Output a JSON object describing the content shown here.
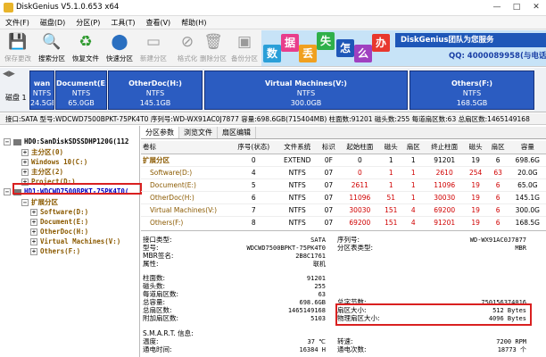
{
  "window": {
    "title": "DiskGenius V5.1.0.653 x64",
    "min": "—",
    "max": "□",
    "close": "✕"
  },
  "menu": [
    "文件(F)",
    "磁盘(D)",
    "分区(P)",
    "工具(T)",
    "查看(V)",
    "帮助(H)"
  ],
  "toolbar": [
    {
      "label": "保存更改",
      "icon": "save-icon",
      "glyph": "💾",
      "enabled": false
    },
    {
      "label": "搜索分区",
      "icon": "search-partition-icon",
      "glyph": "🔍",
      "enabled": true
    },
    {
      "label": "恢复文件",
      "icon": "recover-file-icon",
      "glyph": "♻",
      "enabled": true
    },
    {
      "label": "快速分区",
      "icon": "quick-partition-icon",
      "glyph": "⬤",
      "enabled": true
    },
    {
      "label": "新建分区",
      "icon": "new-partition-icon",
      "glyph": "▭",
      "enabled": false
    },
    {
      "label": "格式化",
      "icon": "format-icon",
      "glyph": "⊘",
      "enabled": false
    },
    {
      "label": "删除分区",
      "icon": "delete-partition-icon",
      "glyph": "🗑",
      "enabled": false
    },
    {
      "label": "备份分区",
      "icon": "backup-partition-icon",
      "glyph": "▣",
      "enabled": false
    }
  ],
  "banner": {
    "chars": [
      "数",
      "据",
      "丢",
      "失",
      "怎",
      "么",
      "办"
    ],
    "brand": "DiskGenius团队为您服务",
    "phone": "QQ: 4000089958(与电话同号)"
  },
  "diskbar": {
    "disk_label": "磁盘 1",
    "partitions": [
      {
        "name": "wan",
        "fs": "NTFS",
        "size": "24.5GB"
      },
      {
        "name": "Document(E:)",
        "fs": "NTFS",
        "size": "65.0GB"
      },
      {
        "name": "OtherDoc(H:)",
        "fs": "NTFS",
        "size": "145.1GB"
      },
      {
        "name": "Virtual Machines(V:)",
        "fs": "NTFS",
        "size": "300.0GB"
      },
      {
        "name": "Others(F:)",
        "fs": "NTFS",
        "size": "168.5GB"
      }
    ]
  },
  "infobar": "接口:SATA  型号:WDCWD7500BPKT-75PK4T0  序列号:WD-WX91AC0J7877  容量:698.6GB(715404MB)  柱面数:91201  磁头数:255  每道扇区数:63  总扇区数:1465149168",
  "tree": {
    "hd0": "HD0:SanDiskSDSSDHP120G(112",
    "hd0_children": [
      "主分区(0)",
      "Windows 10(C:)",
      "主分区(2)",
      "Project(D:)"
    ],
    "hd1": "HD1:WDCWD7500BPKT-75PK4T0(",
    "hd1_children": [
      "扩展分区",
      "Software(D:)",
      "Document(E:)",
      "OtherDoc(H:)",
      "Virtual Machines(V:)",
      "Others(F:)"
    ]
  },
  "tabs": [
    "分区参数",
    "浏览文件",
    "扇区编辑"
  ],
  "ptable": {
    "headers": [
      "卷标",
      "序号(状态)",
      "文件系统",
      "标识",
      "起始柱面",
      "磁头",
      "扇区",
      "终止柱面",
      "磁头",
      "扇区",
      "容量"
    ],
    "rows": [
      [
        "扩展分区",
        "0",
        "EXTEND",
        "0F",
        "0",
        "1",
        "1",
        "91201",
        "19",
        "6",
        "698.6G"
      ],
      [
        "Software(D:)",
        "4",
        "NTFS",
        "07",
        "0",
        "1",
        "1",
        "2610",
        "254",
        "63",
        "20.0G"
      ],
      [
        "Document(E:)",
        "5",
        "NTFS",
        "07",
        "2611",
        "1",
        "1",
        "11096",
        "19",
        "6",
        "65.0G"
      ],
      [
        "OtherDoc(H:)",
        "6",
        "NTFS",
        "07",
        "11096",
        "51",
        "1",
        "30030",
        "19",
        "6",
        "145.1G"
      ],
      [
        "Virtual Machines(V:)",
        "7",
        "NTFS",
        "07",
        "30030",
        "151",
        "4",
        "69200",
        "19",
        "6",
        "300.0G"
      ],
      [
        "Others(F:)",
        "8",
        "NTFS",
        "07",
        "69200",
        "151",
        "4",
        "91201",
        "19",
        "6",
        "168.5G"
      ]
    ]
  },
  "detail": {
    "iface_label": "接口类型:",
    "iface": "SATA",
    "model_label": "型号:",
    "model": "WDCWD7500BPKT-75PK4T0",
    "mbr_label": "MBR签名:",
    "mbr": "2B8C1761",
    "attr_label": "属性:",
    "attr": "联机",
    "serial_label": "序列号:",
    "serial": "WD-WX91AC0J7877",
    "ptype_label": "分区表类型:",
    "ptype": "MBR",
    "cyl_label": "柱面数:",
    "cyl": "91201",
    "heads_label": "磁头数:",
    "heads": "255",
    "spt_label": "每道扇区数:",
    "spt": "63",
    "cap_label": "总容量:",
    "cap": "698.6GB",
    "total_label": "总扇区数:",
    "total": "1465149168",
    "extra_label": "附加扇区数:",
    "extra": "5103",
    "tb_label": "总字节数:",
    "tb": "750156374016",
    "ss_label": "扇区大小:",
    "ss": "512 Bytes",
    "pss_label": "物理扇区大小:",
    "pss": "4096 Bytes",
    "smart_label": "S.M.A.R.T. 信息:",
    "temp_label": "温度:",
    "temp": "37 ℃",
    "hours_label": "通电时间:",
    "hours": "16384 H",
    "rpm_label": "转速:",
    "rpm": "7200 RPM",
    "count_label": "通电次数:",
    "count": "18773 个"
  }
}
